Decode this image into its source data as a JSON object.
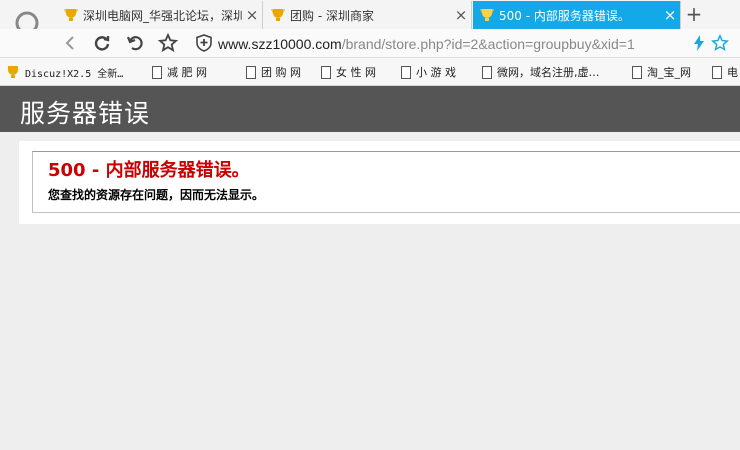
{
  "browser": {
    "tabs": [
      {
        "label": "深圳电脑网_华强北论坛，深圳",
        "active": false
      },
      {
        "label": "团购 - 深圳商家",
        "active": false
      },
      {
        "label": "500 - 内部服务器错误。",
        "active": true
      }
    ],
    "url_host": "www.szz10000.com",
    "url_path": "/brand/store.php?id=2&action=groupbuy&xid=1",
    "bookmarks": [
      "Discuz!X2.5 全新…",
      "减 肥 网",
      "团 购 网",
      "女 性 网",
      "小 游 戏",
      "微网，域名注册,虚…",
      "淘_宝_网",
      "电"
    ],
    "accent_color": "#13a8e8"
  },
  "page": {
    "header": "服务器错误",
    "error_title": "500 - 内部服务器错误。",
    "error_description": "您查找的资源存在问题，因而无法显示。",
    "header_bg": "#555555",
    "error_color": "#cc0000"
  }
}
